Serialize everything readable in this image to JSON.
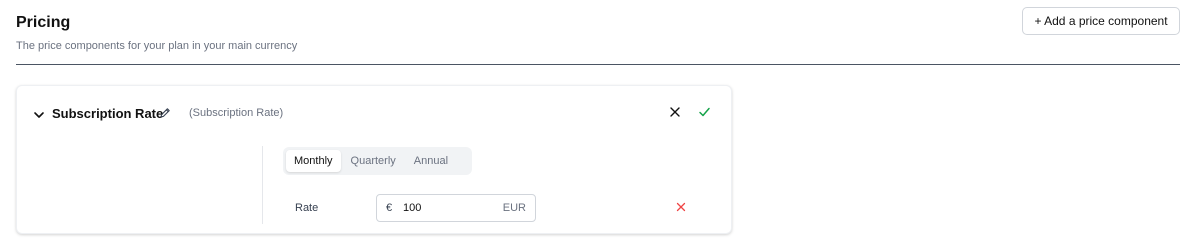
{
  "header": {
    "title": "Pricing",
    "subtitle": "The price components for your plan in your main currency",
    "add_button_label": "+ Add a price component"
  },
  "component": {
    "name": "Subscription Rate",
    "type_label": "(Subscription Rate)",
    "tabs": [
      {
        "label": "Monthly",
        "active": true
      },
      {
        "label": "Quarterly",
        "active": false
      },
      {
        "label": "Annual",
        "active": false
      }
    ],
    "rate": {
      "label": "Rate",
      "currency_symbol": "€",
      "value": "100",
      "currency_code": "EUR"
    }
  },
  "colors": {
    "confirm": "#16a34a",
    "remove": "#ef4444",
    "divider": "#4b5563"
  },
  "icons": [
    "chevron-down-icon",
    "pencil-icon",
    "close-icon",
    "check-icon",
    "remove-x-icon"
  ]
}
